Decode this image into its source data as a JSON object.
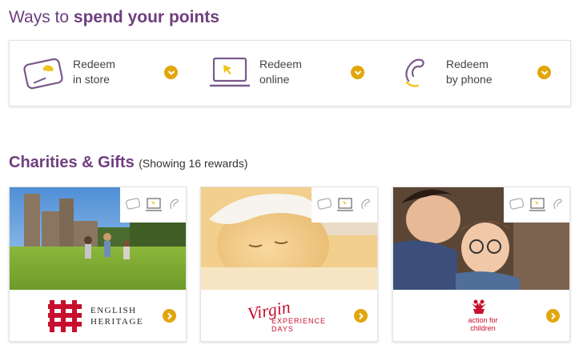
{
  "ways": {
    "title_prefix": "Ways to",
    "title_bold": "spend your points",
    "options": [
      {
        "line1": "Redeem",
        "line2": "in store",
        "icon": "card-icon"
      },
      {
        "line1": "Redeem",
        "line2": "online",
        "icon": "laptop-icon"
      },
      {
        "line1": "Redeem",
        "line2": "by phone",
        "icon": "phone-icon"
      }
    ]
  },
  "section": {
    "title": "Charities & Gifts",
    "count": "(Showing 16 rewards)"
  },
  "rewards": [
    {
      "logo_line1": "ENGLISH",
      "logo_line2": "HERITAGE"
    },
    {
      "logo_main": "Virgin",
      "logo_line1": "EXPERIENCE",
      "logo_line2": "DAYS"
    },
    {
      "logo_line1": "action for",
      "logo_line2": "children"
    }
  ],
  "colors": {
    "purple": "#6e3f7e",
    "accent": "#e2a60d",
    "red": "#c8102e"
  }
}
